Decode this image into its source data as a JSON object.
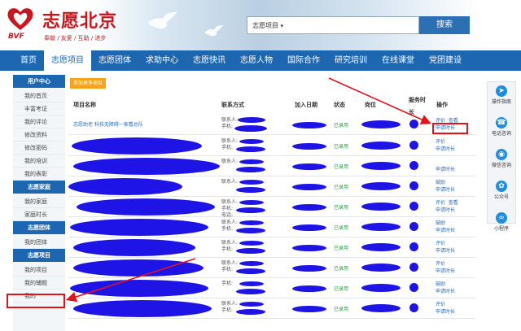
{
  "brand": {
    "title": "志愿北京",
    "abbr": "BVF",
    "slogan": "奉献 / 友爱 / 互助 / 进步",
    "color": "#c9171e"
  },
  "search": {
    "category": "志愿项目",
    "button": "搜索"
  },
  "nav": [
    "首页",
    "志愿项目",
    "志愿团体",
    "求助中心",
    "志愿快讯",
    "志愿人物",
    "国际合作",
    "研究培训",
    "在线课堂",
    "党团建设"
  ],
  "sidebar": {
    "sections": [
      {
        "title": "用户中心",
        "items": [
          "我的首页",
          "丰富考证",
          "我的评论",
          "修改资料",
          "修改密码",
          "我的培训",
          "我的表彰"
        ]
      },
      {
        "title": "志愿家庭",
        "items": [
          "我的家庭",
          "家庭时长"
        ]
      },
      {
        "title": "志愿团体",
        "items": [
          "我的团体"
        ]
      },
      {
        "title": "志愿项目",
        "items": [
          "我的项目",
          "我的辅题",
          "我的"
        ]
      }
    ]
  },
  "main": {
    "add_button": "参加更多项目",
    "headers": {
      "name": "项目名称",
      "contact": "联系方式",
      "date": "加入日期",
      "status": "状态",
      "position": "岗位",
      "hours": "服务时长",
      "ops": "操作"
    },
    "first_row": {
      "name": "志愿助老 科技无障碍一家看总队",
      "contact_a": "联系人:",
      "contact_b": "手机:",
      "status": "已录用",
      "op1": "评价",
      "op2": "查看",
      "op3": "申请时长"
    },
    "rows": [
      {
        "contact": [
          "联系人:",
          "手机:"
        ],
        "status": "已录用",
        "ops": [
          "评价",
          "申请时长"
        ]
      },
      {
        "contact": [
          "联系人:"
        ],
        "status": "已录用",
        "ops": [
          "",
          "申请时长"
        ]
      },
      {
        "contact": [
          "联系人:"
        ],
        "status": "已录用",
        "ops": [
          "鼓励",
          "申请时长"
        ]
      },
      {
        "contact": [
          "联系人:",
          "手机:",
          "电话:"
        ],
        "status": "已录用",
        "ops": [
          "评价",
          "查看",
          "申请时长"
        ]
      },
      {
        "contact": [
          "联系人:",
          "手机:"
        ],
        "status": "已录用",
        "ops": [
          "鼓励",
          "申请时长"
        ]
      },
      {
        "contact": [
          "联系人:",
          "手机:"
        ],
        "status": "已录用",
        "ops": [
          "评价",
          "申请时长"
        ]
      },
      {
        "contact": [
          "联系人:",
          "手机:"
        ],
        "status": "已录用",
        "ops": [
          "评价",
          "申请时长"
        ]
      },
      {
        "contact": [
          "手机:"
        ],
        "status": "已录用",
        "ops": [
          "鼓励",
          "申请时长"
        ]
      },
      {
        "contact": [
          "联系人:",
          "手机:"
        ],
        "status": "已录用",
        "ops": [
          "评价",
          "申请时长"
        ]
      }
    ]
  },
  "right_panel": [
    {
      "label": "操作指南",
      "icon": "paper-plane-icon"
    },
    {
      "label": "电话咨询",
      "icon": "headset-icon"
    },
    {
      "label": "微信咨询",
      "icon": "wechat-icon"
    },
    {
      "label": "公众号",
      "icon": "weibo-icon"
    },
    {
      "label": "小程序",
      "icon": "mini-program-icon"
    }
  ],
  "colors": {
    "nav": "#1d67b1",
    "accent": "#f7a21a",
    "scribble": "#1e14e6",
    "highlight": "#e2141b"
  }
}
